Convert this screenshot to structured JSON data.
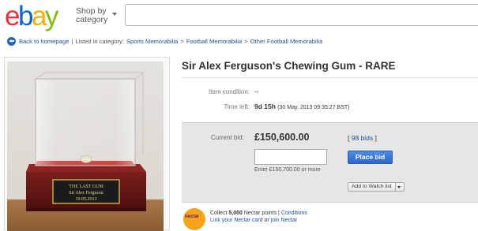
{
  "header": {
    "logo_letters": [
      {
        "ch": "e",
        "color": "#e53238"
      },
      {
        "ch": "b",
        "color": "#0064d2"
      },
      {
        "ch": "a",
        "color": "#f5af02"
      },
      {
        "ch": "y",
        "color": "#86b817"
      }
    ],
    "shop_by_line1": "Shop by",
    "shop_by_line2": "category"
  },
  "breadcrumb": {
    "back_label": "Back to homepage",
    "divider": "|",
    "listed_label": "Listed in category:",
    "categories": [
      "Sports Memorabilia",
      "Football Memorabilia",
      "Other Football Memorabilia"
    ],
    "separator": ">"
  },
  "photo": {
    "plaque_line1": "THE LAST GUM",
    "plaque_line2": "Sir Alex Ferguson",
    "plaque_line3": "19.05.2013"
  },
  "listing": {
    "title": "Sir Alex Ferguson's Chewing Gum - RARE",
    "condition_label": "Item condition:",
    "condition_value": "--",
    "time_left_label": "Time left:",
    "time_left_value": "9d 15h",
    "time_left_detail": "(30 May, 2013  09:35:27 BST)"
  },
  "bid": {
    "current_label": "Current bid:",
    "current_value": "£150,600.00",
    "bids_open": "[",
    "bids_link": "98 bids",
    "bids_close": "]",
    "input_value": "",
    "place_bid_label": "Place bid",
    "enter_note": "Enter £150,700.00 or more",
    "watch_label": "Add to Watch list"
  },
  "nectar": {
    "logo_text": "nectar",
    "collect_prefix": "Collect",
    "points_bold": "5,000",
    "points_text": "Nectar points",
    "divider": "|",
    "conditions_link": "Conditions",
    "link_card": "Link your Nectar card",
    "or_text": "or",
    "join_link": "join Nectar"
  }
}
